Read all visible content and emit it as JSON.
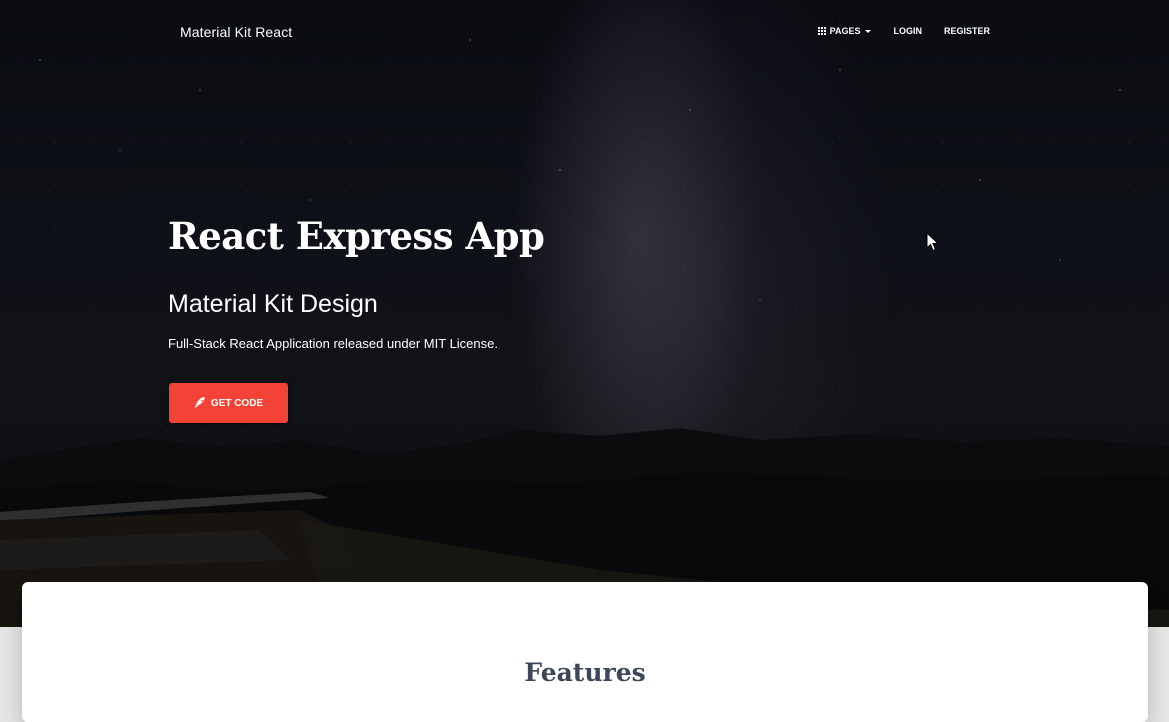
{
  "nav": {
    "brand": "Material Kit React",
    "pages_label": "PAGES",
    "login_label": "LOGIN",
    "register_label": "REGISTER"
  },
  "hero": {
    "title": "React Express App",
    "subtitle": "Material Kit Design",
    "description": "Full-Stack React Application released under MIT License.",
    "cta_label": "GET CODE"
  },
  "features": {
    "title": "Features"
  },
  "icons": {
    "pages": "apps-grid-icon",
    "pages_dropdown": "caret-down-icon",
    "cta": "rocket-icon",
    "cursor": "mouse-pointer-icon"
  },
  "colors": {
    "accent": "#f44336",
    "heading": "#3c4858",
    "hero_text": "#ffffff"
  }
}
